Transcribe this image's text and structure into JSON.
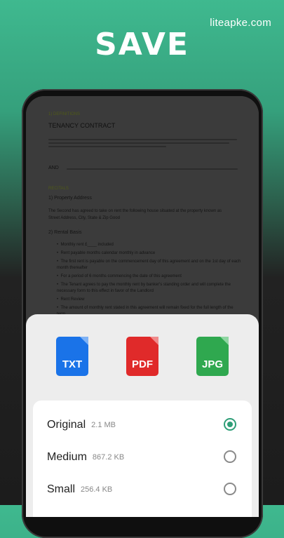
{
  "watermark": "liteapke.com",
  "headline": "SAVE",
  "document": {
    "heading": "1) DEFINITIONS",
    "title": "TENANCY CONTRACT",
    "and_label": "AND",
    "recitals": "RECITALS",
    "section1": "1)  Property Address",
    "agree_line": "The Second has agreed to take on rent the following house situated at the property known as",
    "address_line": "Street Address, City, State & Zip Good",
    "section2": "2)  Rental Basis",
    "bullets": [
      "Monthly rent £____ included",
      "Rent payable months calendar monthly in advance",
      "The first rent is payable on the commencement day of this agreement and on the 1st day of each month thereafter",
      "For a period of 6 months commencing the date of this agreement",
      "The Tenant agrees to pay the monthly rent by banker's standing order and will complete the necessary form to this effect in favor of the Landlord",
      "Rent Review",
      "The amount of monthly rent stated in this agreement will remain fixed for the full length of the term..."
    ]
  },
  "formats": [
    {
      "label": "TXT",
      "icon": "txt-file-icon",
      "color": "#1a73e8",
      "fold": "#7fb2f5"
    },
    {
      "label": "PDF",
      "icon": "pdf-file-icon",
      "color": "#e02a2a",
      "fold": "#f08b8b"
    },
    {
      "label": "JPG",
      "icon": "jpg-file-icon",
      "color": "#2fa84f",
      "fold": "#8fd6a2"
    }
  ],
  "options": [
    {
      "name": "Original",
      "size": "2.1 MB",
      "selected": true
    },
    {
      "name": "Medium",
      "size": "867.2 KB",
      "selected": false
    },
    {
      "name": "Small",
      "size": "256.4 KB",
      "selected": false
    }
  ],
  "colors": {
    "accent": "#2e9e77",
    "background_top": "#3fb98f"
  }
}
